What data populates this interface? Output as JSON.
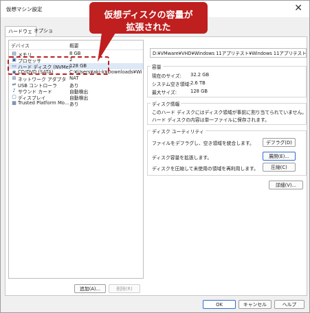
{
  "window": {
    "title": "仮想マシン設定",
    "close_glyph": "✕"
  },
  "tabs": [
    {
      "label": "ハードウェア"
    },
    {
      "label": "オプション"
    }
  ],
  "device_list": {
    "col_device": "デバイス",
    "col_summary": "概要",
    "rows": [
      {
        "icon": "memory-icon",
        "glyph": "▤",
        "name": "メモリ",
        "summary": "8 GB"
      },
      {
        "icon": "processor-icon",
        "glyph": "▣",
        "name": "プロセッサ",
        "summary": "2"
      },
      {
        "icon": "hard-disk-icon",
        "glyph": "▭",
        "name": "ハード ディスク (NVMe)",
        "summary": "128 GB"
      },
      {
        "icon": "cd-dvd-icon",
        "glyph": "◉",
        "name": "CD/DVD (SATA)",
        "summary": "C:¥Users¥aki-k¥Downloads¥Win..."
      },
      {
        "icon": "network-adapter-icon",
        "glyph": "⊞",
        "name": "ネットワーク アダプタ",
        "summary": "NAT"
      },
      {
        "icon": "usb-controller-icon",
        "glyph": "⇌",
        "name": "USB コントローラ",
        "summary": "あり"
      },
      {
        "icon": "sound-card-icon",
        "glyph": "♪",
        "name": "サウンド カード",
        "summary": "自動検出"
      },
      {
        "icon": "display-icon",
        "glyph": "▢",
        "name": "ディスプレイ",
        "summary": "自動検出"
      },
      {
        "icon": "tpm-icon",
        "glyph": "▦",
        "name": "Trusted Platform Mo...",
        "summary": "あり"
      }
    ],
    "add_label": "追加(A)...",
    "remove_label": "削除(R)"
  },
  "disk_file": {
    "path": "D:¥VMware¥VHD¥Windows 11アプリテスト¥Windows 11アプリテスト.vmdk"
  },
  "capacity": {
    "label": "容量",
    "current_size_label": "現在のサイズ:",
    "current_size": "32.2 GB",
    "system_free_label": "システム空き領域:",
    "system_free": "2.6 TB",
    "max_size_label": "最大サイズ:",
    "max_size": "128 GB"
  },
  "disk_info": {
    "label": "ディスク情報",
    "line1": "このハード ディスクにはディスク領域が事前に割り当てられていません。",
    "line2": "ハード ディスクの内容は単一ファイルに保存されます。"
  },
  "disk_utility": {
    "label": "ディスク ユーティリティ",
    "defrag_text": "ファイルをデフラグし、空き領域を統合します。",
    "defrag_button": "デフラグ(D)",
    "expand_text": "ディスク容量を拡張します。",
    "expand_button": "展開(E)...",
    "compact_text": "ディスクを圧縮して未使用の領域を再利用します。",
    "compact_button": "圧縮(C)"
  },
  "advanced_button": "詳細(V)...",
  "footer": {
    "ok": "OK",
    "cancel": "キャンセル",
    "help": "ヘルプ"
  },
  "callout": {
    "line1": "仮想ディスクの容量が",
    "line2": "拡張された",
    "color": "#bf1f1f"
  }
}
